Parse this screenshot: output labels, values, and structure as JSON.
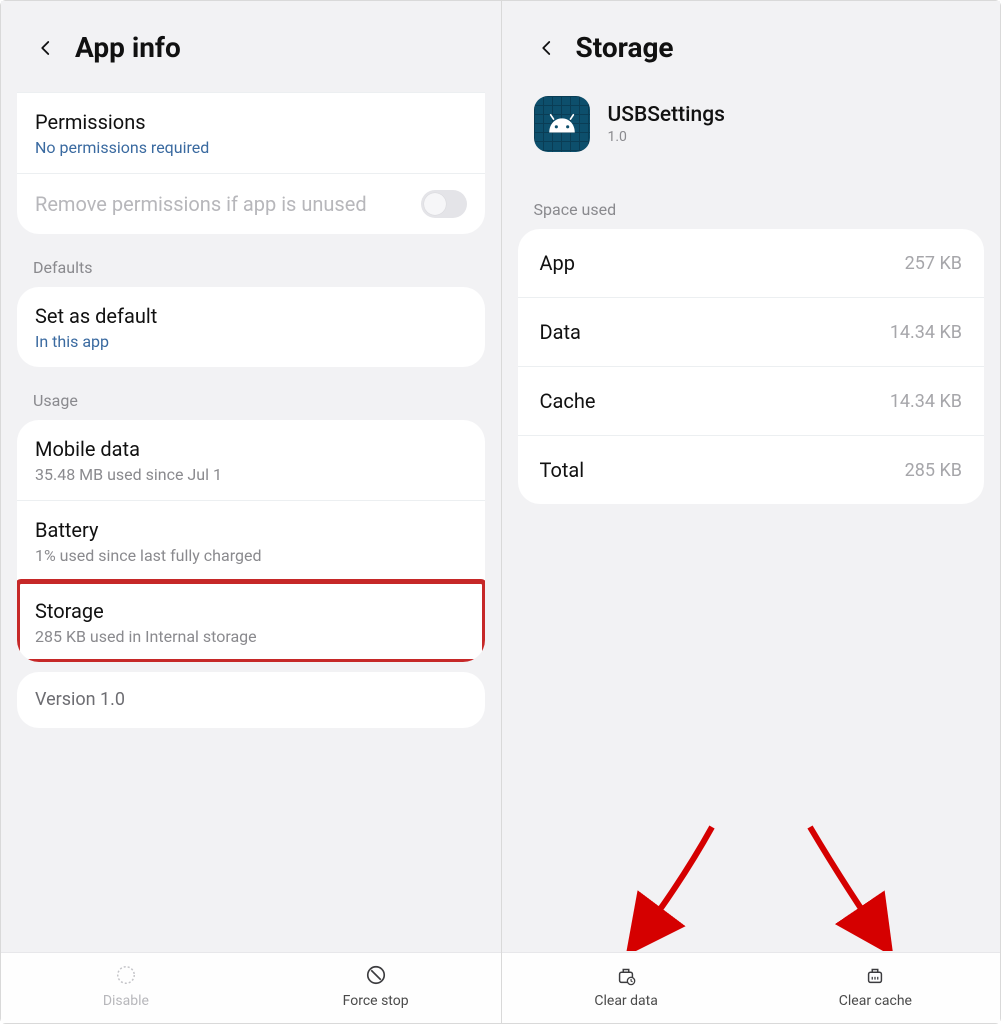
{
  "left": {
    "header_title": "App info",
    "permissions": {
      "title": "Permissions",
      "sub": "No permissions required"
    },
    "remove_perm": {
      "title": "Remove permissions if app is unused"
    },
    "sections": {
      "defaults": "Defaults",
      "usage": "Usage"
    },
    "set_default": {
      "title": "Set as default",
      "sub": "In this app"
    },
    "mobile_data": {
      "title": "Mobile data",
      "sub": "35.48 MB used since Jul 1"
    },
    "battery": {
      "title": "Battery",
      "sub": "1% used since last fully charged"
    },
    "storage": {
      "title": "Storage",
      "sub": "285 KB used in Internal storage"
    },
    "version": "Version 1.0",
    "bottom": {
      "disable": "Disable",
      "force_stop": "Force stop"
    }
  },
  "right": {
    "header_title": "Storage",
    "app": {
      "name": "USBSettings",
      "version": "1.0"
    },
    "section_space": "Space used",
    "rows": {
      "app_label": "App",
      "app_val": "257 KB",
      "data_label": "Data",
      "data_val": "14.34 KB",
      "cache_label": "Cache",
      "cache_val": "14.34 KB",
      "total_label": "Total",
      "total_val": "285 KB"
    },
    "bottom": {
      "clear_data": "Clear data",
      "clear_cache": "Clear cache"
    }
  }
}
